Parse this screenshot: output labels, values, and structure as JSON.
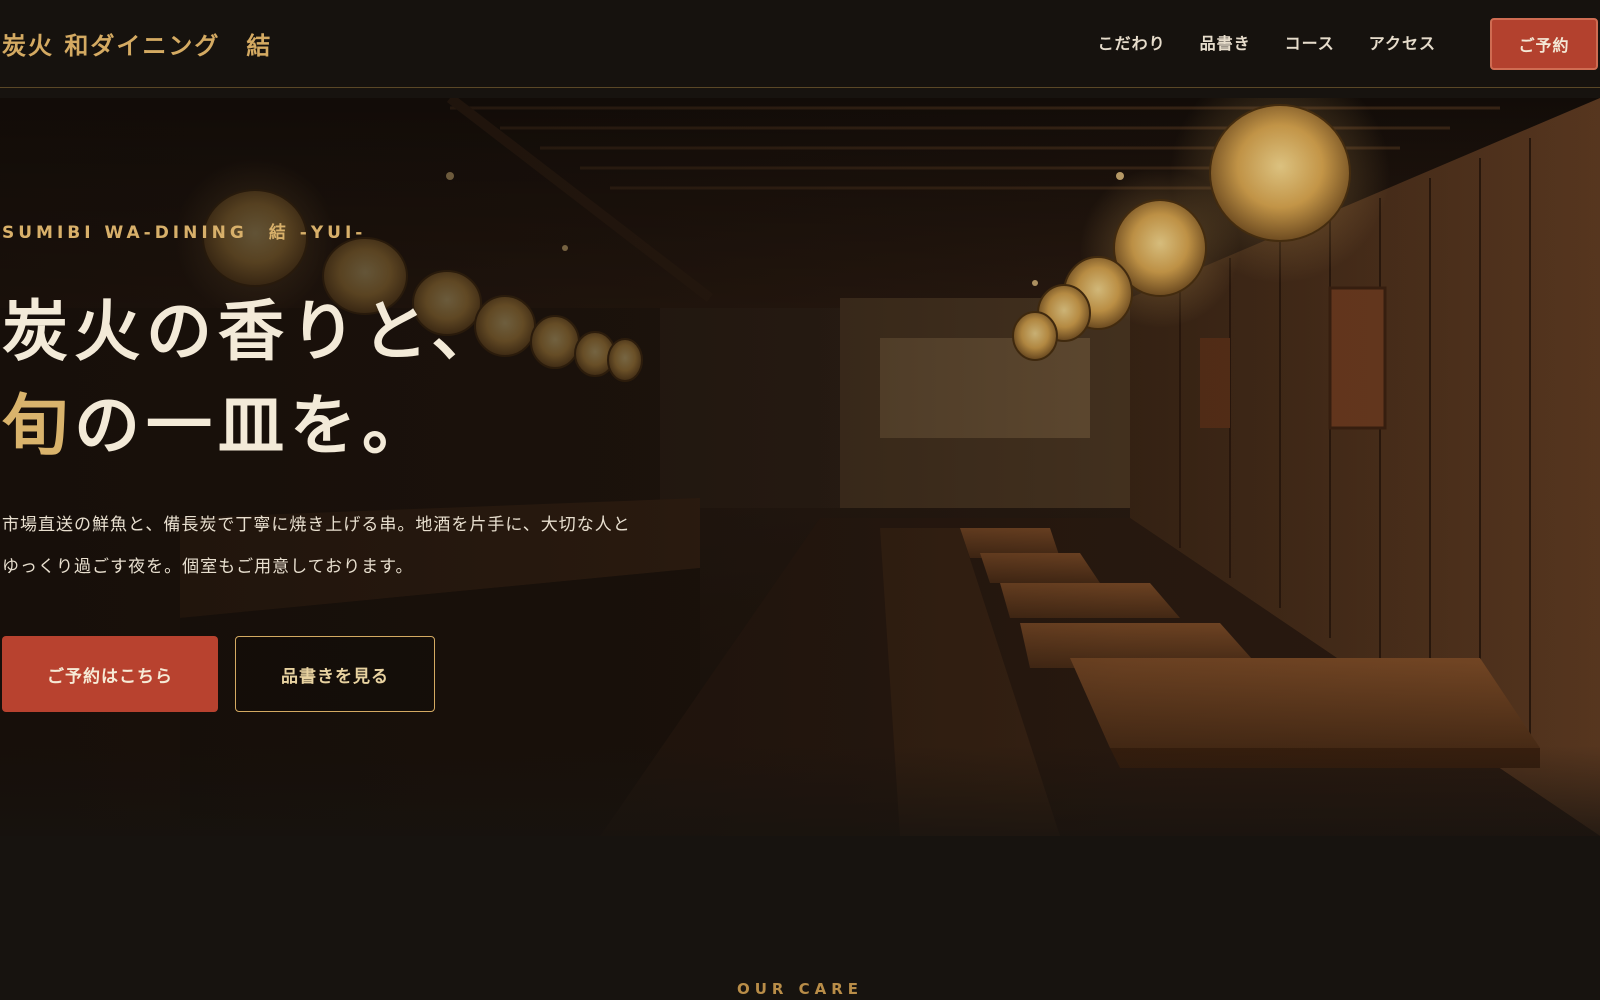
{
  "header": {
    "logo": "炭火 和ダイニング　結",
    "nav": [
      {
        "label": "こだわり"
      },
      {
        "label": "品書き"
      },
      {
        "label": "コース"
      },
      {
        "label": "アクセス"
      }
    ],
    "reserve_label": "ご予約"
  },
  "hero": {
    "eyebrow": "SUMIBI WA-DINING　結 -YUI-",
    "headline_line1": "炭火の香りと、",
    "headline_line2_accent": "旬",
    "headline_line2_rest": "の一皿を。",
    "lead": "市場直送の鮮魚と、備長炭で丁寧に焼き上げる串。地酒を片手に、大切な人とゆっくり過ごす夜を。個室もご用意しております。",
    "primary_cta": "ご予約はこちら",
    "secondary_cta": "品書きを見る"
  },
  "section_next": {
    "eyebrow": "OUR CARE"
  },
  "colors": {
    "background": "#17130f",
    "gold": "#d4aa62",
    "vermilion": "#b8422f",
    "cream": "#f3ead8"
  }
}
